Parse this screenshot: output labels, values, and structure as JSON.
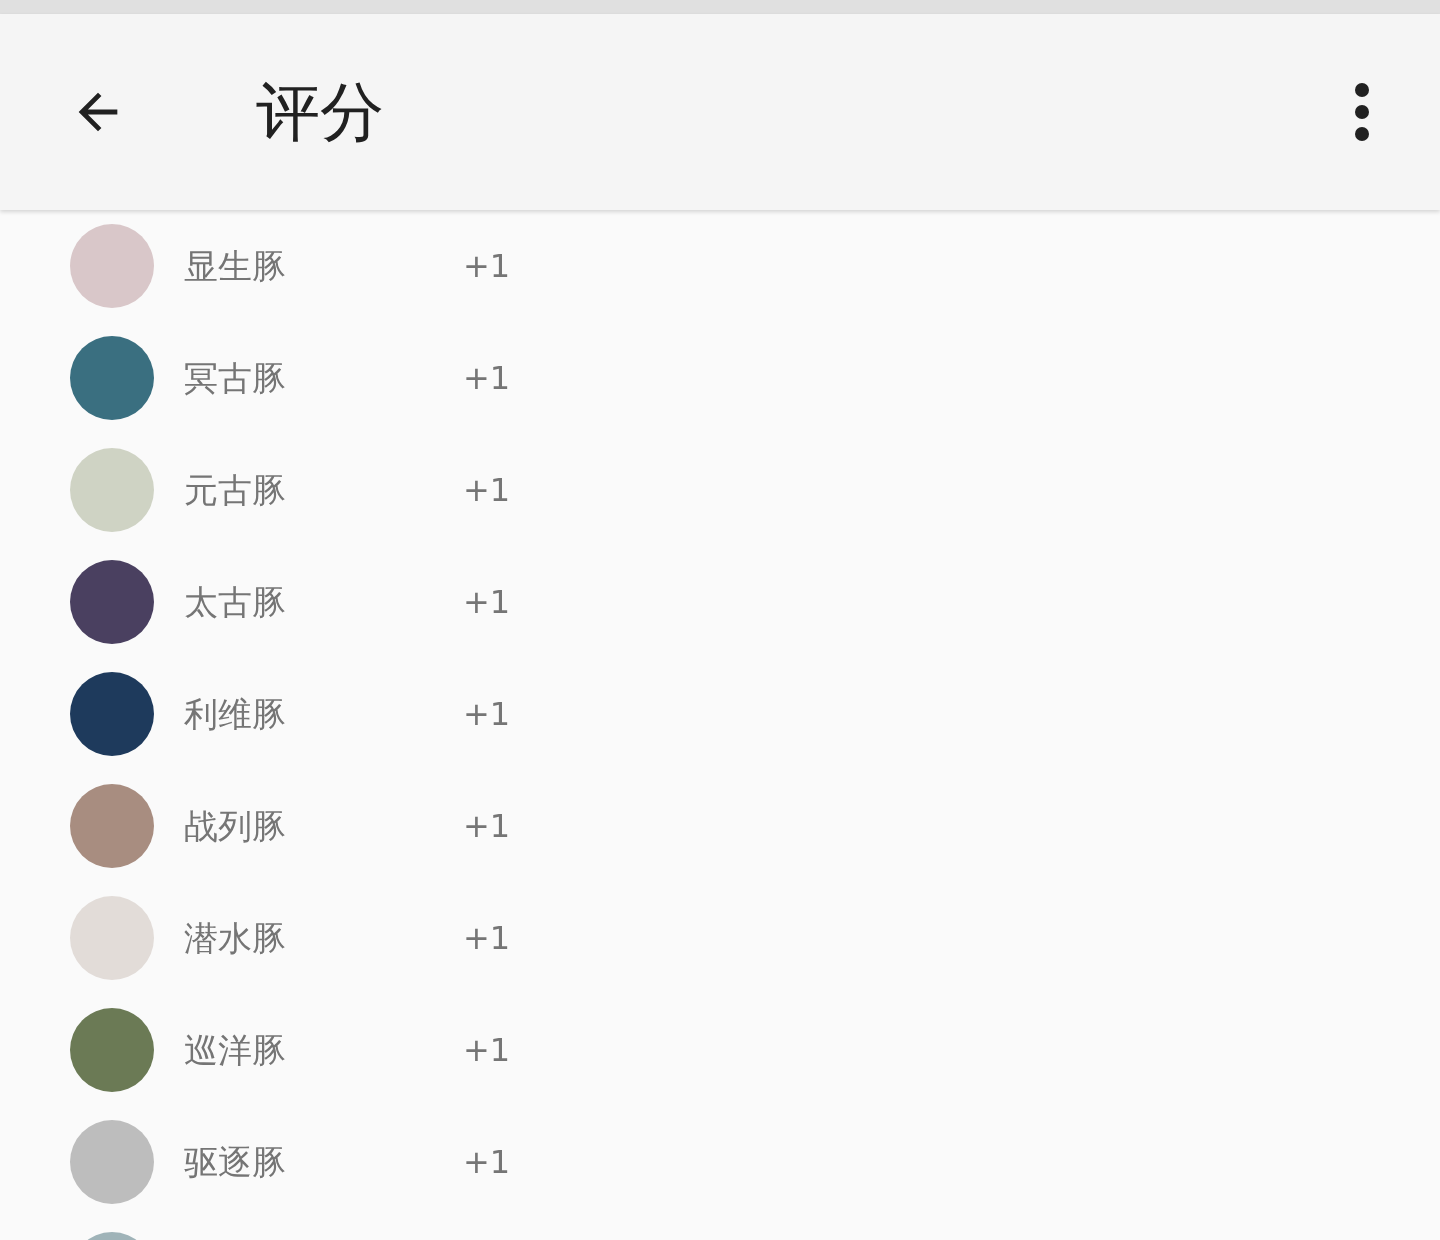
{
  "app_bar": {
    "title": "评分"
  },
  "ratings": [
    {
      "name": "显生豚",
      "score": "+1"
    },
    {
      "name": "冥古豚",
      "score": "+1"
    },
    {
      "name": "元古豚",
      "score": "+1"
    },
    {
      "name": "太古豚",
      "score": "+1"
    },
    {
      "name": "利维豚",
      "score": "+1"
    },
    {
      "name": "战列豚",
      "score": "+1"
    },
    {
      "name": "潜水豚",
      "score": "+1"
    },
    {
      "name": "巡洋豚",
      "score": "+1"
    },
    {
      "name": "驱逐豚",
      "score": "+1"
    }
  ]
}
